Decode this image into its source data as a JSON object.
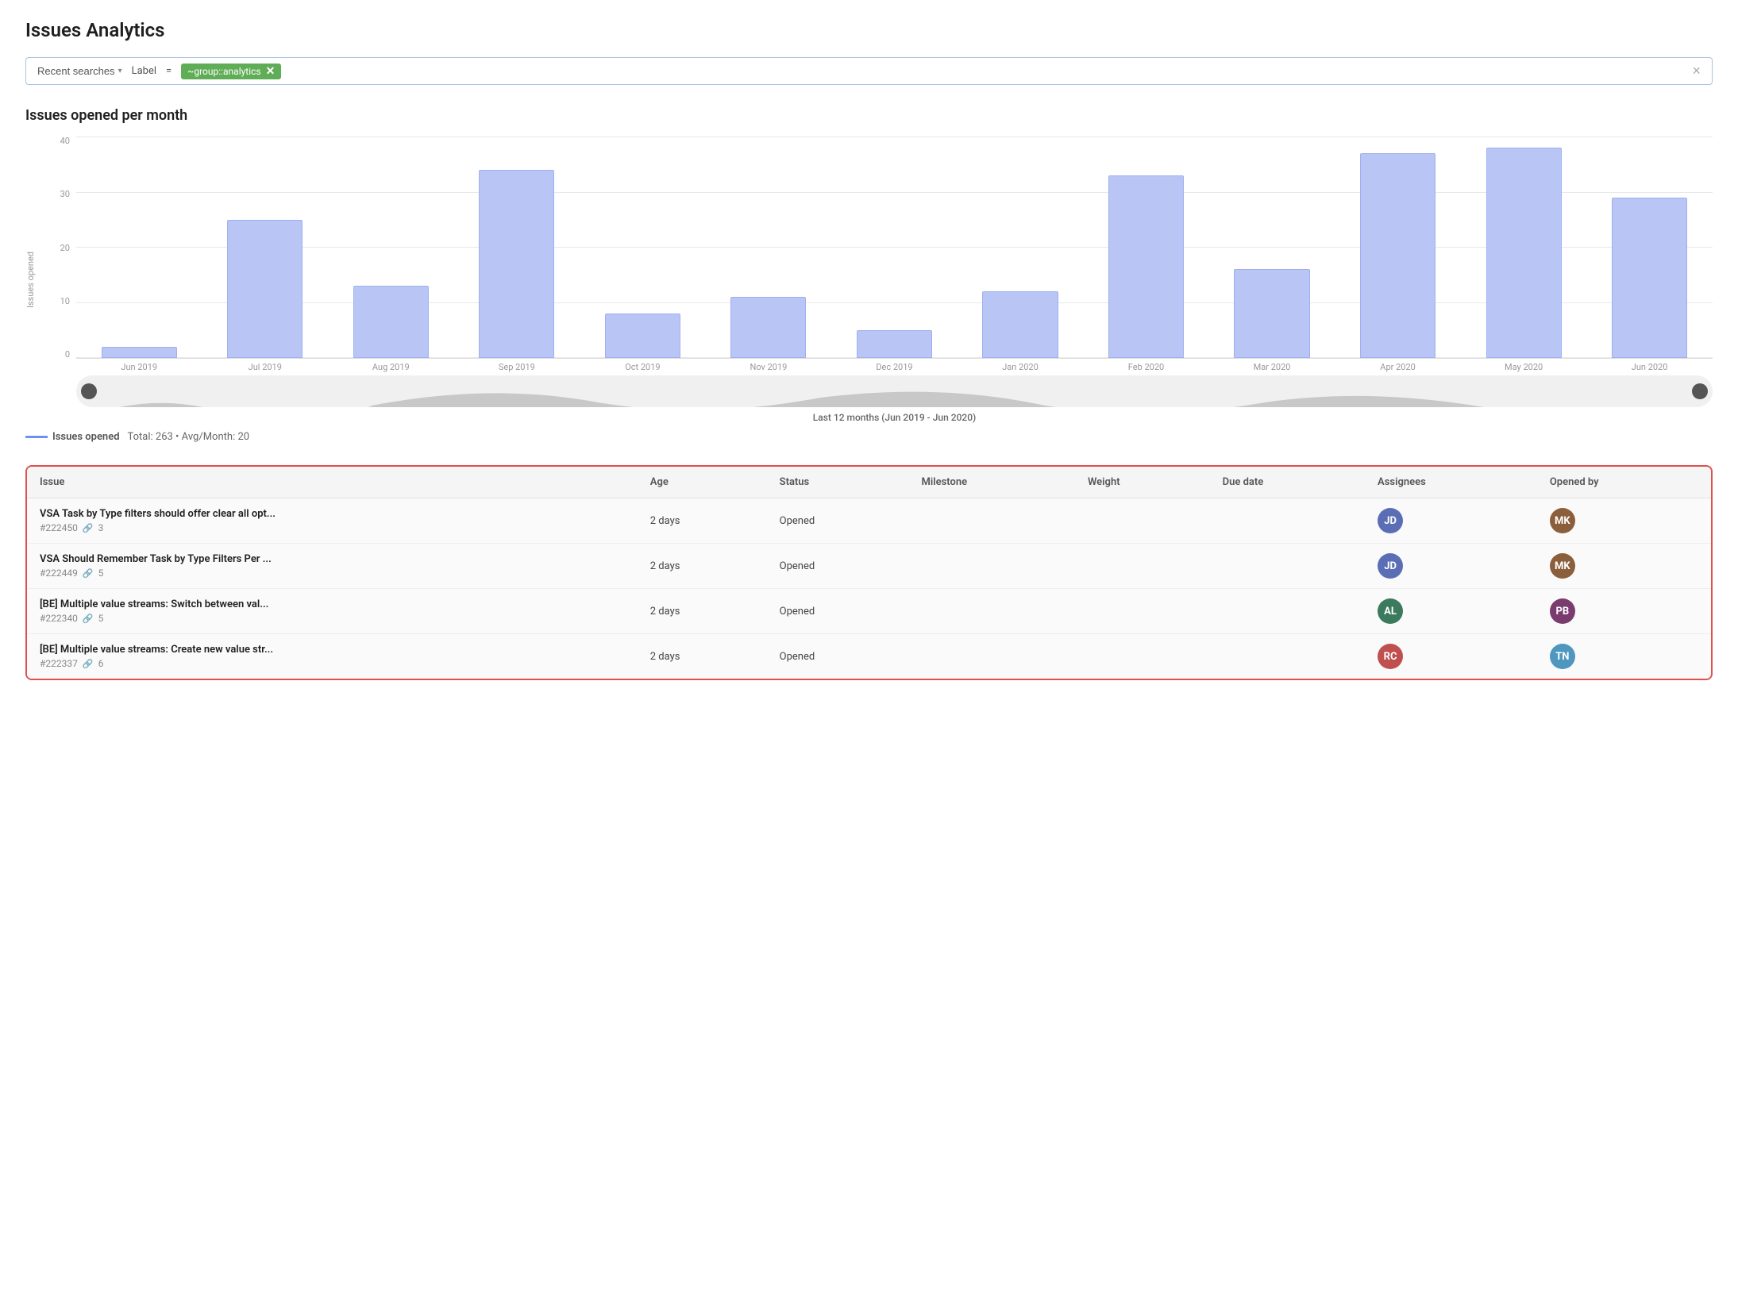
{
  "page": {
    "title": "Issues Analytics"
  },
  "searchbar": {
    "recent_searches_label": "Recent searches",
    "filter_label": "Label",
    "filter_operator": "=",
    "filter_value": "~group::analytics",
    "clear_button": "×"
  },
  "chart": {
    "title": "Issues opened per month",
    "y_axis_label": "Issues opened",
    "y_labels": [
      "0",
      "10",
      "20",
      "30",
      "40"
    ],
    "range_label": "Last 12 months (Jun 2019 - Jun 2020)",
    "bars": [
      {
        "label": "Jun 2019",
        "value": 2,
        "max": 40
      },
      {
        "label": "Jul 2019",
        "value": 25,
        "max": 40
      },
      {
        "label": "Aug 2019",
        "value": 13,
        "max": 40
      },
      {
        "label": "Sep 2019",
        "value": 34,
        "max": 40
      },
      {
        "label": "Oct 2019",
        "value": 8,
        "max": 40
      },
      {
        "label": "Nov 2019",
        "value": 11,
        "max": 40
      },
      {
        "label": "Dec 2019",
        "value": 5,
        "max": 40
      },
      {
        "label": "Jan 2020",
        "value": 12,
        "max": 40
      },
      {
        "label": "Feb 2020",
        "value": 33,
        "max": 40
      },
      {
        "label": "Mar 2020",
        "value": 16,
        "max": 40
      },
      {
        "label": "Apr 2020",
        "value": 37,
        "max": 40
      },
      {
        "label": "May 2020",
        "value": 38,
        "max": 40
      },
      {
        "label": "Jun 2020",
        "value": 29,
        "max": 40
      }
    ],
    "legend": {
      "label": "Issues opened",
      "stats": "Total: 263 • Avg/Month: 20"
    }
  },
  "table": {
    "columns": [
      "Issue",
      "Age",
      "Status",
      "Milestone",
      "Weight",
      "Due date",
      "Assignees",
      "Opened by"
    ],
    "rows": [
      {
        "title": "VSA Task by Type filters should offer clear all opt...",
        "number": "#222450",
        "weight": "3",
        "age": "2 days",
        "status": "Opened",
        "milestone": "",
        "weight_val": "",
        "due_date": "",
        "assignee_initials": "JD",
        "assignee_color": "avatar-1",
        "opener_initials": "MK",
        "opener_color": "avatar-2"
      },
      {
        "title": "VSA Should Remember Task by Type Filters Per ...",
        "number": "#222449",
        "weight": "5",
        "age": "2 days",
        "status": "Opened",
        "milestone": "",
        "weight_val": "",
        "due_date": "",
        "assignee_initials": "JD",
        "assignee_color": "avatar-1",
        "opener_initials": "MK",
        "opener_color": "avatar-2"
      },
      {
        "title": "[BE] Multiple value streams: Switch between val...",
        "number": "#222340",
        "weight": "5",
        "age": "2 days",
        "status": "Opened",
        "milestone": "",
        "weight_val": "",
        "due_date": "",
        "assignee_initials": "AL",
        "assignee_color": "avatar-3",
        "opener_initials": "PB",
        "opener_color": "avatar-4"
      },
      {
        "title": "[BE] Multiple value streams: Create new value str...",
        "number": "#222337",
        "weight": "6",
        "age": "2 days",
        "status": "Opened",
        "milestone": "",
        "weight_val": "",
        "due_date": "",
        "assignee_initials": "RC",
        "assignee_color": "avatar-5",
        "opener_initials": "TN",
        "opener_color": "avatar-6"
      }
    ]
  }
}
